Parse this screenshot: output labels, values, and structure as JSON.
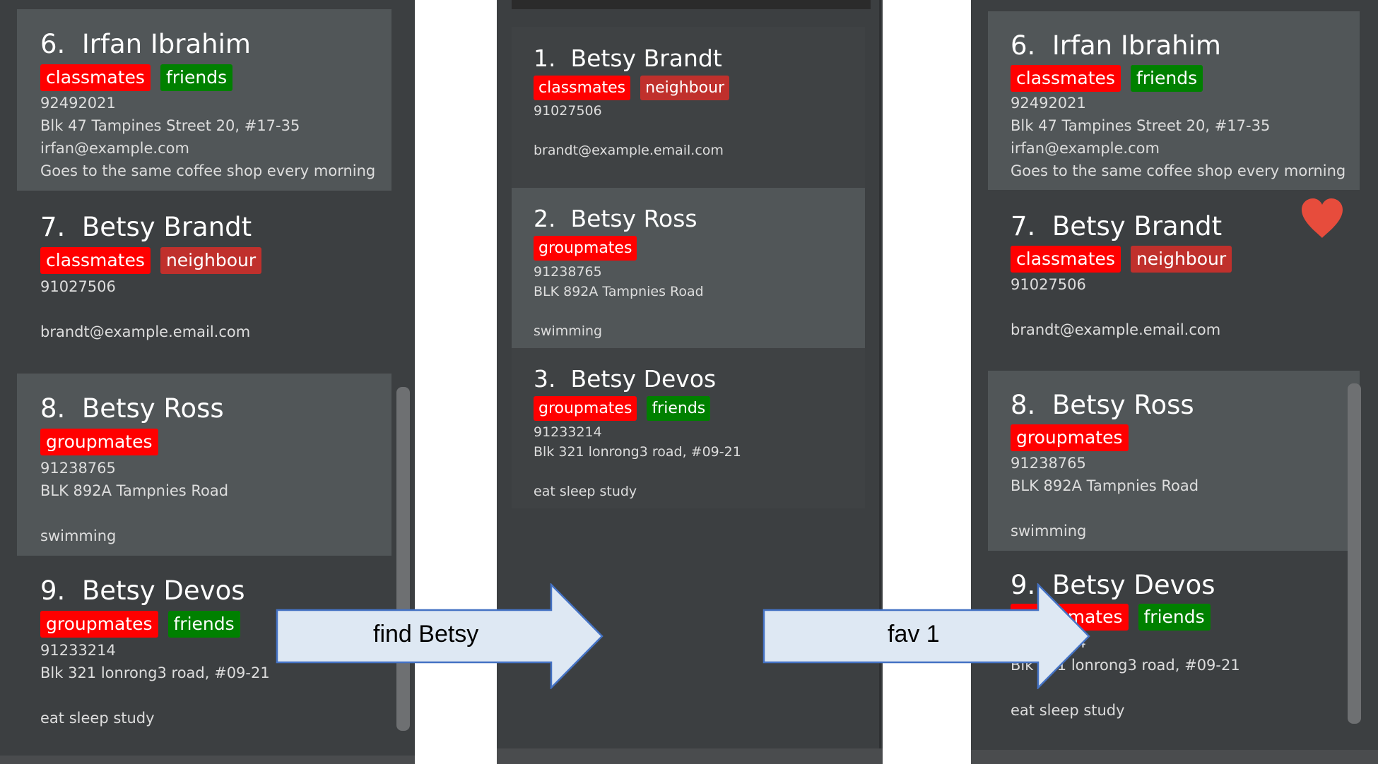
{
  "panel_before": {
    "cards": [
      {
        "index": "6.",
        "name": "Irfan Ibrahim",
        "tags": [
          {
            "text": "classmates",
            "color": "red"
          },
          {
            "text": "friends",
            "color": "green"
          }
        ],
        "lines": [
          "92492021",
          "Blk 47 Tampines Street 20, #17-35",
          "irfan@example.com",
          "Goes to the same coffee shop every morning"
        ]
      },
      {
        "index": "7.",
        "name": "Betsy Brandt",
        "tags": [
          {
            "text": "classmates",
            "color": "red"
          },
          {
            "text": "neighbour",
            "color": "dred"
          }
        ],
        "lines": [
          "91027506",
          "",
          "brandt@example.email.com"
        ]
      },
      {
        "index": "8.",
        "name": "Betsy Ross",
        "tags": [
          {
            "text": "groupmates",
            "color": "red"
          }
        ],
        "lines": [
          "91238765",
          "BLK 892A Tampnies Road",
          "",
          "swimming"
        ]
      },
      {
        "index": "9.",
        "name": "Betsy Devos",
        "tags": [
          {
            "text": "groupmates",
            "color": "red"
          },
          {
            "text": "friends",
            "color": "green"
          }
        ],
        "lines": [
          "91233214",
          "Blk 321 lonrong3 road, #09-21",
          "",
          "eat sleep study"
        ]
      }
    ]
  },
  "panel_find": {
    "cards": [
      {
        "index": "1.",
        "name": "Betsy Brandt",
        "tags": [
          {
            "text": "classmates",
            "color": "red"
          },
          {
            "text": "neighbour",
            "color": "dred"
          }
        ],
        "lines": [
          "91027506",
          "",
          "brandt@example.email.com"
        ]
      },
      {
        "index": "2.",
        "name": "Betsy Ross",
        "tags": [
          {
            "text": "groupmates",
            "color": "red"
          }
        ],
        "lines": [
          "91238765",
          "BLK 892A Tampnies Road",
          "",
          "swimming"
        ]
      },
      {
        "index": "3.",
        "name": "Betsy Devos",
        "tags": [
          {
            "text": "groupmates",
            "color": "red"
          },
          {
            "text": "friends",
            "color": "green"
          }
        ],
        "lines": [
          "91233214",
          "Blk 321 lonrong3 road, #09-21",
          "",
          "eat sleep study"
        ]
      }
    ]
  },
  "panel_after": {
    "cards": [
      {
        "index": "6.",
        "name": "Irfan Ibrahim",
        "tags": [
          {
            "text": "classmates",
            "color": "red"
          },
          {
            "text": "friends",
            "color": "green"
          }
        ],
        "lines": [
          "92492021",
          "Blk 47 Tampines Street 20, #17-35",
          "irfan@example.com",
          "Goes to the same coffee shop every morning"
        ]
      },
      {
        "index": "7.",
        "name": "Betsy Brandt",
        "tags": [
          {
            "text": "classmates",
            "color": "red"
          },
          {
            "text": "neighbour",
            "color": "dred"
          }
        ],
        "lines": [
          "91027506",
          "",
          "brandt@example.email.com"
        ],
        "favourite": true
      },
      {
        "index": "8.",
        "name": "Betsy Ross",
        "tags": [
          {
            "text": "groupmates",
            "color": "red"
          }
        ],
        "lines": [
          "91238765",
          "BLK 892A Tampnies Road",
          "",
          "swimming"
        ]
      },
      {
        "index": "9.",
        "name": "Betsy Devos",
        "tags": [
          {
            "text": "groupmates",
            "color": "red"
          },
          {
            "text": "friends",
            "color": "green"
          }
        ],
        "lines": [
          "91233214",
          "Blk 321 lonrong3 road, #09-21",
          "",
          "eat sleep study"
        ]
      }
    ]
  },
  "arrows": {
    "find_label": "find Betsy",
    "fav_label": "fav 1",
    "fill": "#dee8f3",
    "stroke": "#4472c4"
  },
  "icons": {
    "heart": "heart-icon"
  },
  "colors": {
    "tag_red": "#ff0000",
    "tag_dark_red": "#c0302c",
    "tag_green": "#008000",
    "card_light": "#515658",
    "card_dark": "#3c3f41",
    "heart": "#e74c3c"
  }
}
